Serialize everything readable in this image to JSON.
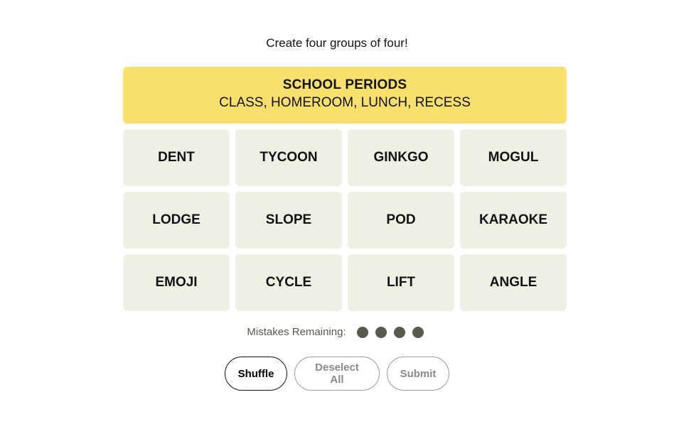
{
  "header": {
    "subtitle": "Create four groups of four!"
  },
  "solved_groups": [
    {
      "title": "SCHOOL PERIODS",
      "members": "CLASS, HOMEROOM, LUNCH, RECESS",
      "color": "#f9df6d"
    }
  ],
  "tiles": [
    "DENT",
    "TYCOON",
    "GINKGO",
    "MOGUL",
    "LODGE",
    "SLOPE",
    "POD",
    "KARAOKE",
    "EMOJI",
    "CYCLE",
    "LIFT",
    "ANGLE"
  ],
  "mistakes": {
    "label": "Mistakes Remaining:",
    "remaining": 4,
    "dot_color": "#5a594e"
  },
  "buttons": {
    "shuffle": "Shuffle",
    "deselect": "Deselect All",
    "submit": "Submit"
  }
}
